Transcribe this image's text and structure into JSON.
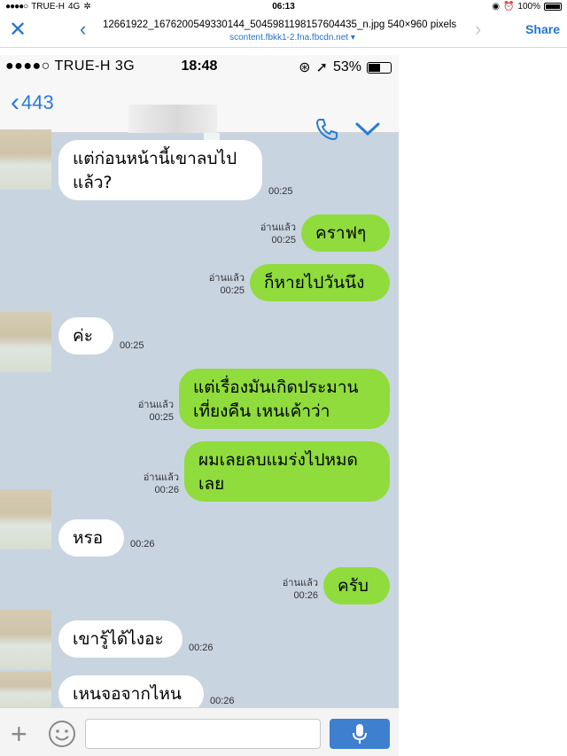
{
  "os_status": {
    "carrier": "TRUE-H",
    "network": "4G",
    "time": "06:13",
    "battery": "100%"
  },
  "viewer": {
    "file_name": "12661922_1676200549330144_5045981198157604435_n.jpg 540×960 pixels",
    "file_source": "scontent.fbkk1-2.fna.fbcdn.net",
    "share_label": "Share"
  },
  "phone": {
    "carrier": "TRUE-H",
    "network": "3G",
    "time": "18:48",
    "battery": "53%",
    "back_count": "443"
  },
  "messages": [
    {
      "dir": "in",
      "text_lines": [
        "แต่ก่อนหน้านี้เขาลบไป",
        "แล้ว?"
      ],
      "time": "00:25"
    },
    {
      "dir": "out",
      "text_lines": [
        "คราฟๆ"
      ],
      "read": "อ่านแล้ว",
      "time": "00:25"
    },
    {
      "dir": "out",
      "text_lines": [
        "ก็หายไปวันนึง"
      ],
      "read": "อ่านแล้ว",
      "time": "00:25"
    },
    {
      "dir": "in",
      "text_lines": [
        "ค่ะ"
      ],
      "time": "00:25"
    },
    {
      "dir": "out",
      "text_lines": [
        "แต่เรื่องมันเกิดประมาน",
        "เที่ยงคืน เหนเค้าว่า"
      ],
      "read": "อ่านแล้ว",
      "time": "00:25"
    },
    {
      "dir": "out",
      "text_lines": [
        "ผมเลยลบแมร่งไปหมด",
        "เลย"
      ],
      "read": "อ่านแล้ว",
      "time": "00:26"
    },
    {
      "dir": "in",
      "text_lines": [
        "หรอ"
      ],
      "time": "00:26"
    },
    {
      "dir": "out",
      "text_lines": [
        "ครับ"
      ],
      "read": "อ่านแล้ว",
      "time": "00:26"
    },
    {
      "dir": "in",
      "text_lines": [
        "เขารู้ได้ไงอะ"
      ],
      "time": "00:26"
    },
    {
      "dir": "in",
      "text_lines": [
        "เหนจอจากไหน"
      ],
      "time": "00:26"
    }
  ],
  "colors": {
    "chat_bg": "#c8d4e0",
    "outgoing_bubble": "#8fdc3c",
    "incoming_bubble": "#ffffff",
    "accent": "#2a7bd4"
  }
}
